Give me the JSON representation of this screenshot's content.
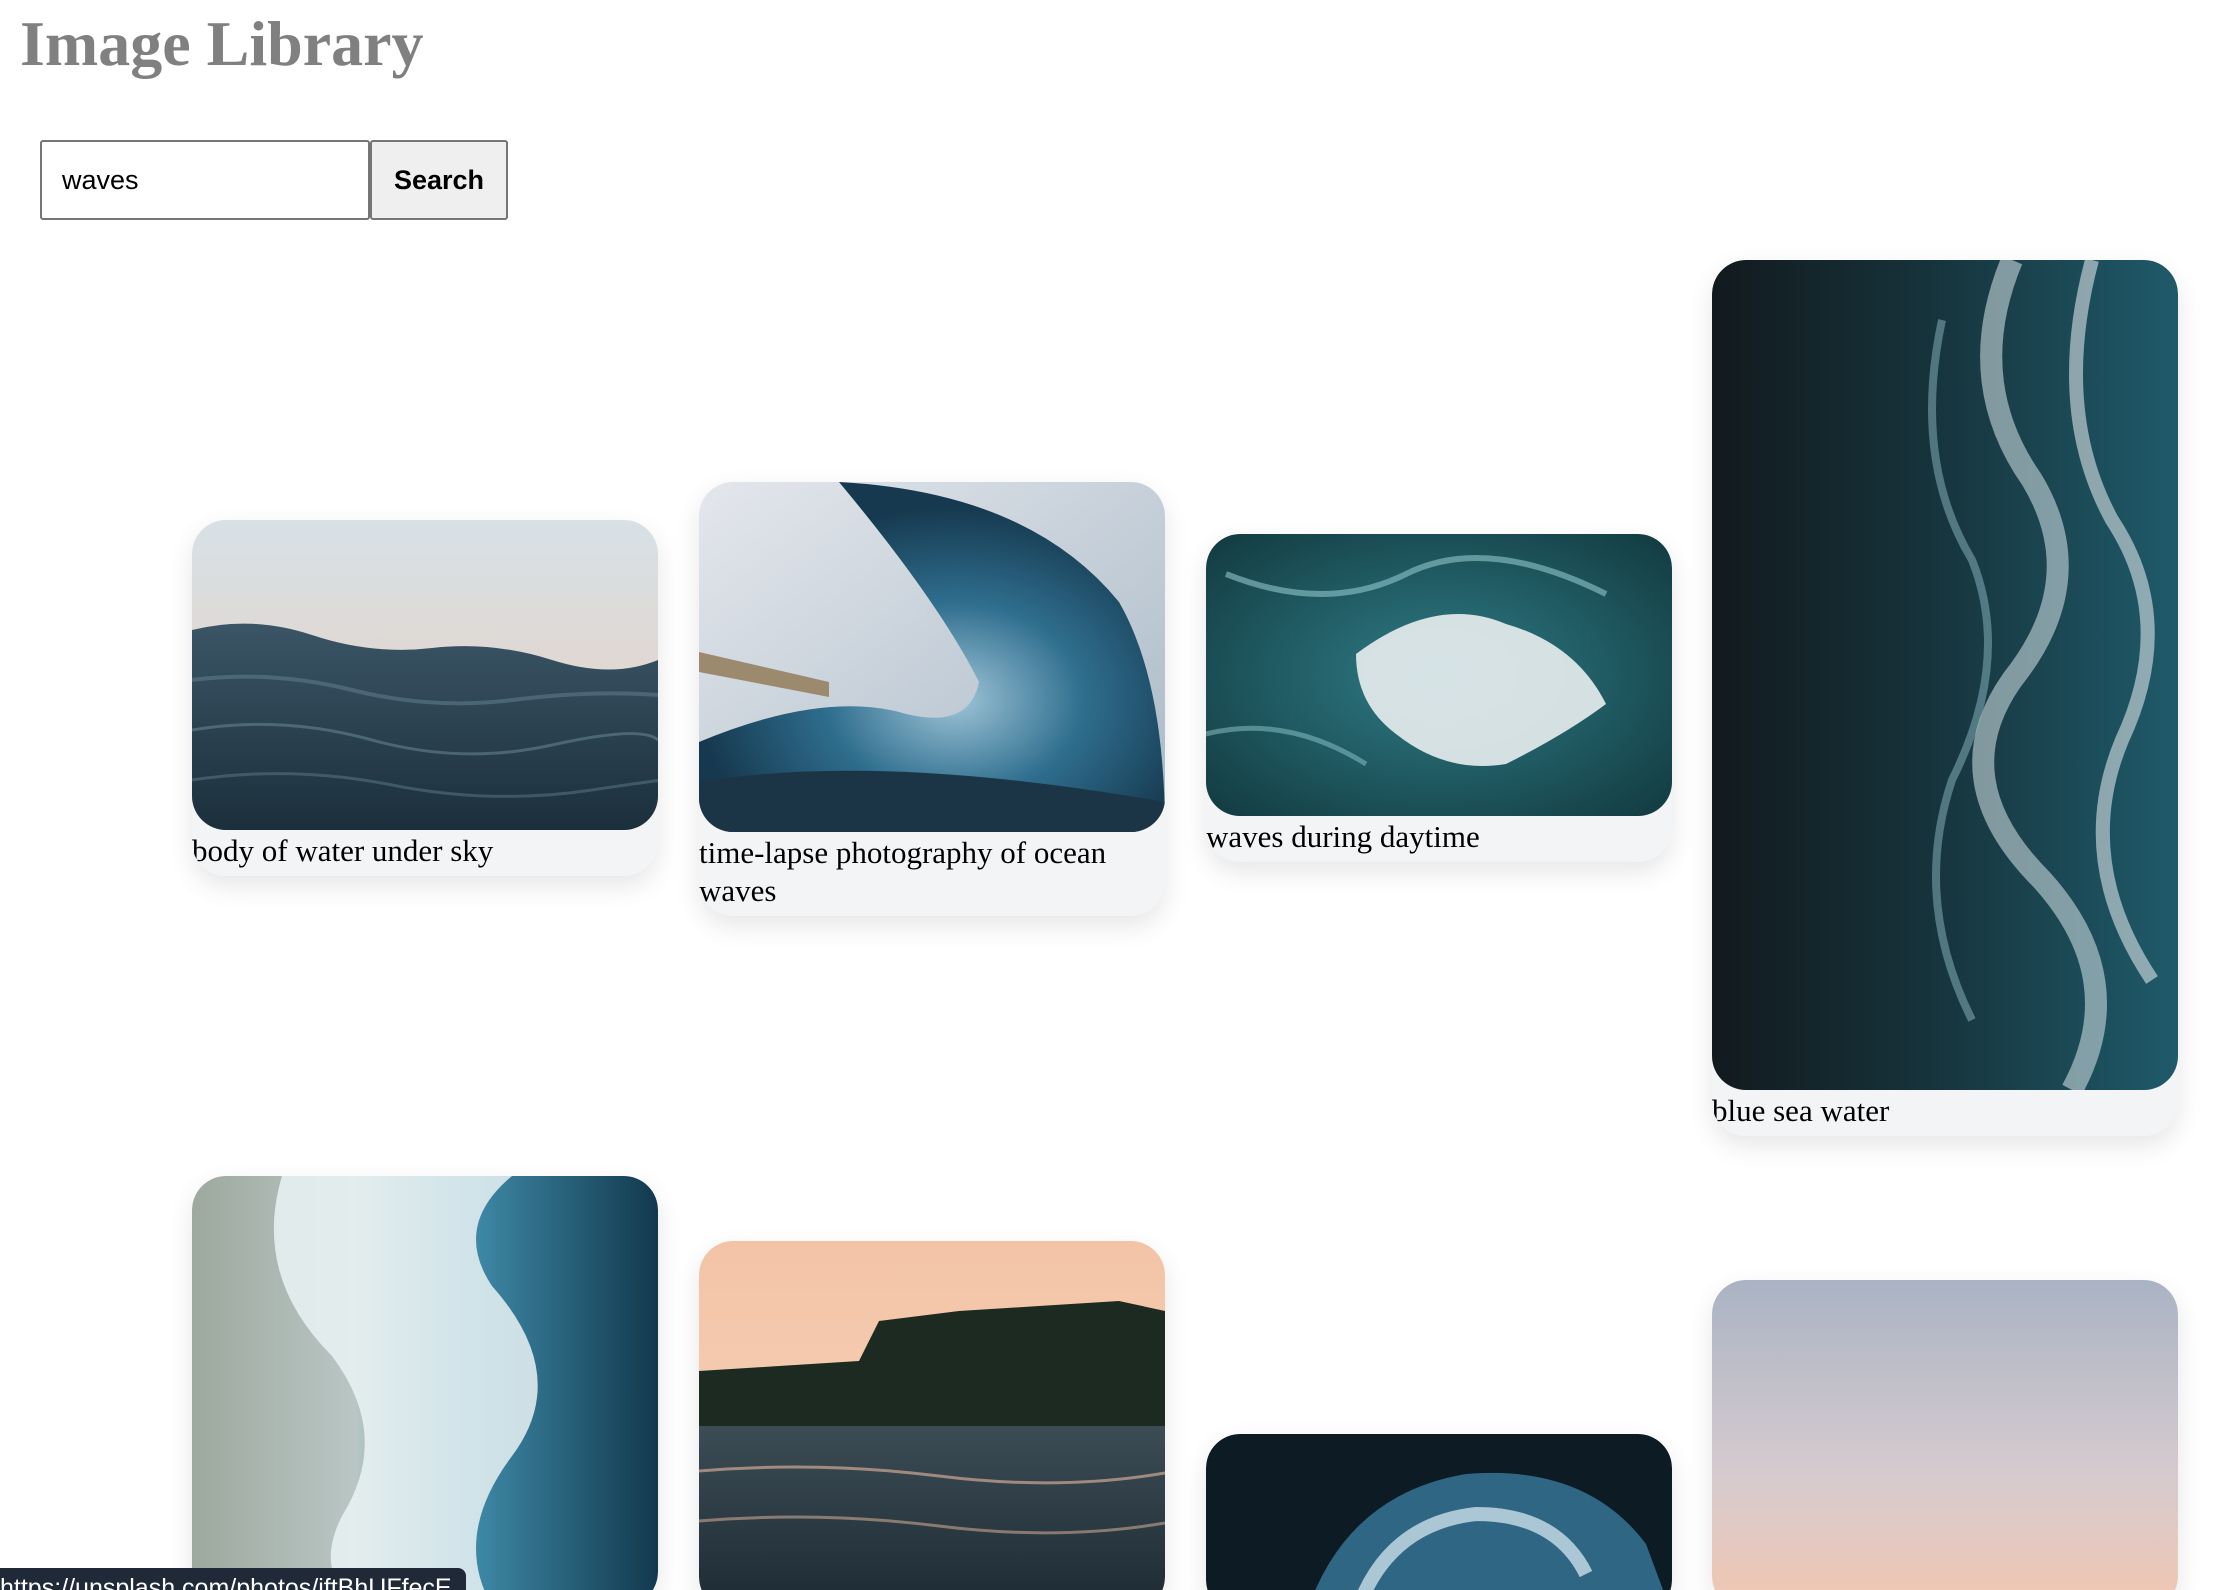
{
  "header": {
    "title": "Image Library"
  },
  "search": {
    "value": "waves",
    "button_label": "Search"
  },
  "cards": [
    {
      "caption": "body of water under sky"
    },
    {
      "caption": "time-lapse photography of ocean waves"
    },
    {
      "caption": "waves during daytime"
    },
    {
      "caption": "blue sea water"
    },
    {
      "caption": ""
    },
    {
      "caption": ""
    },
    {
      "caption": ""
    },
    {
      "caption": ""
    }
  ],
  "status": {
    "url": "https://unsplash.com/photos/iftBhUFfecE"
  },
  "colors": {
    "title": "#808080",
    "card_bg": "#f3f4f6",
    "status_bg": "#1f2937",
    "button_bg": "#efefef"
  }
}
